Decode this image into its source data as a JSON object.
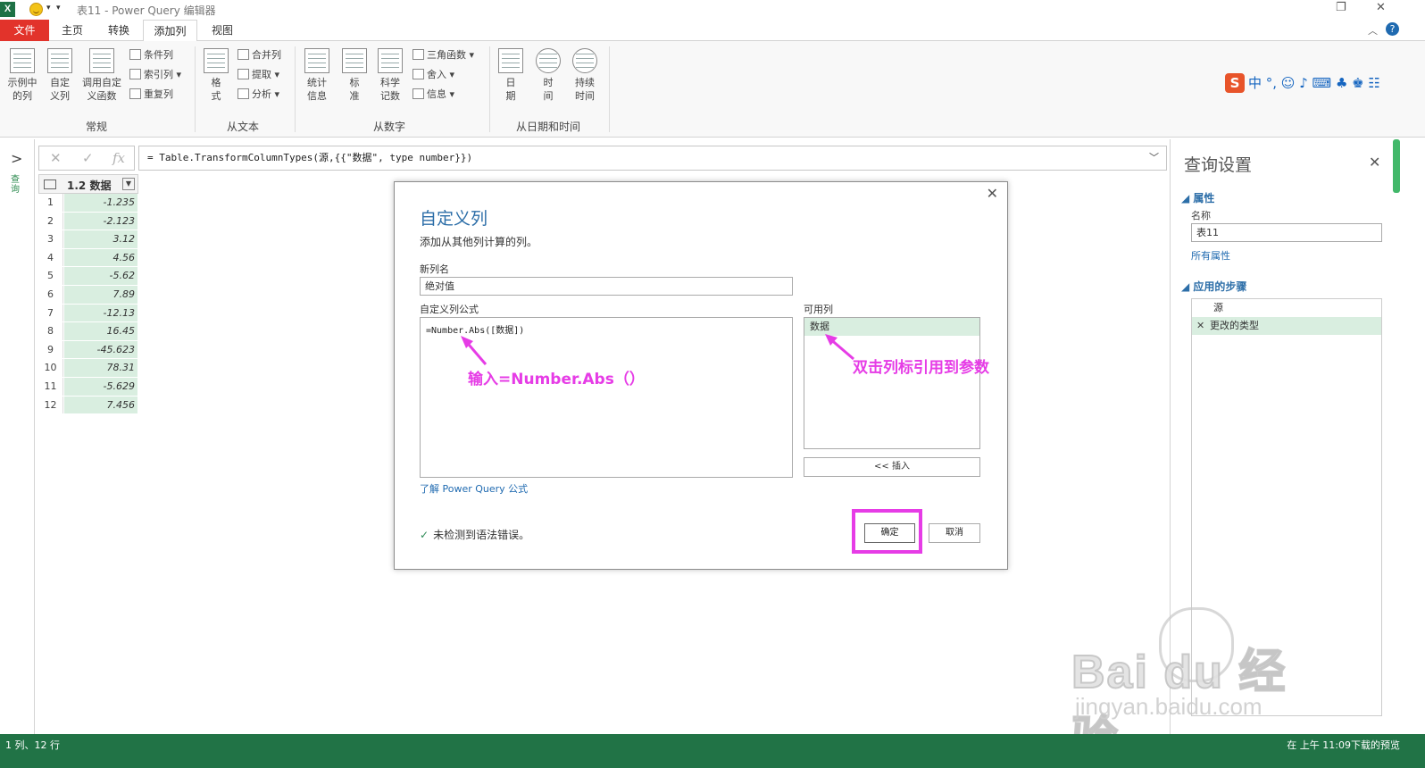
{
  "titlebar": {
    "title": "表11 - Power Query 编辑器",
    "logo": "X"
  },
  "tabs": [
    {
      "label": "文件"
    },
    {
      "label": "主页"
    },
    {
      "label": "转换"
    },
    {
      "label": "添加列"
    },
    {
      "label": "视图"
    }
  ],
  "ribbon": {
    "general": {
      "example_col": "示例中的列",
      "custom_col": "自定义列",
      "invoke_fn": "调用自定义函数",
      "conditional": "条件列",
      "index": "索引列",
      "duplicate": "重复列",
      "group": "常规"
    },
    "text": {
      "format": "格式",
      "merge": "合并列",
      "extract": "提取",
      "parse": "分析",
      "group": "从文本"
    },
    "number": {
      "stats": "统计信息",
      "standard": "标准",
      "sci": "科学记数",
      "trig": "三角函数",
      "round": "舍入",
      "info": "信息",
      "group": "从数字"
    },
    "datetime": {
      "date": "日期",
      "time": "时间",
      "duration": "持续时间",
      "group": "从日期和时间"
    },
    "ime": "中 °, ☺ ♪ ⌨ ♣ ♚ ☷"
  },
  "formula_bar": {
    "expression": "= Table.TransformColumnTypes(源,{{\"数据\", type number}})"
  },
  "nav": {
    "collapsed_label": "查询"
  },
  "grid": {
    "type_label": "1.2",
    "header": "数据",
    "rows": [
      {
        "idx": "1",
        "val": "-1.235"
      },
      {
        "idx": "2",
        "val": "-2.123"
      },
      {
        "idx": "3",
        "val": "3.12"
      },
      {
        "idx": "4",
        "val": "4.56"
      },
      {
        "idx": "5",
        "val": "-5.62"
      },
      {
        "idx": "6",
        "val": "7.89"
      },
      {
        "idx": "7",
        "val": "-12.13"
      },
      {
        "idx": "8",
        "val": "16.45"
      },
      {
        "idx": "9",
        "val": "-45.623"
      },
      {
        "idx": "10",
        "val": "78.31"
      },
      {
        "idx": "11",
        "val": "-5.629"
      },
      {
        "idx": "12",
        "val": "7.456"
      }
    ]
  },
  "dialog": {
    "title": "自定义列",
    "description": "添加从其他列计算的列。",
    "newcol_label": "新列名",
    "newcol_value": "绝对值",
    "formula_label": "自定义列公式",
    "formula_value": "=Number.Abs([数据])",
    "avail_label": "可用列",
    "avail_items": [
      "数据"
    ],
    "insert_label": "<< 插入",
    "learn_link": "了解 Power Query 公式",
    "syntax_status": "未检测到语法错误。",
    "ok_label": "确定",
    "cancel_label": "取消",
    "annotation_formula": "输入=Number.Abs（）",
    "annotation_avail": "双击列标引用到参数"
  },
  "settings": {
    "title": "查询设置",
    "props_label": "属性",
    "name_label": "名称",
    "name_value": "表11",
    "all_props": "所有属性",
    "steps_label": "应用的步骤",
    "steps": [
      "源",
      "更改的类型"
    ]
  },
  "status": {
    "left": "1 列、12 行",
    "right": "在 上午 11:09下载的预览"
  },
  "watermark": {
    "brand": "Bai du 经验",
    "url": "jingyan.baidu.com"
  },
  "colors": {
    "accent": "#217346",
    "file_tab": "#e2332b",
    "highlight": "#e63ce6",
    "selection": "#d9eee0"
  }
}
